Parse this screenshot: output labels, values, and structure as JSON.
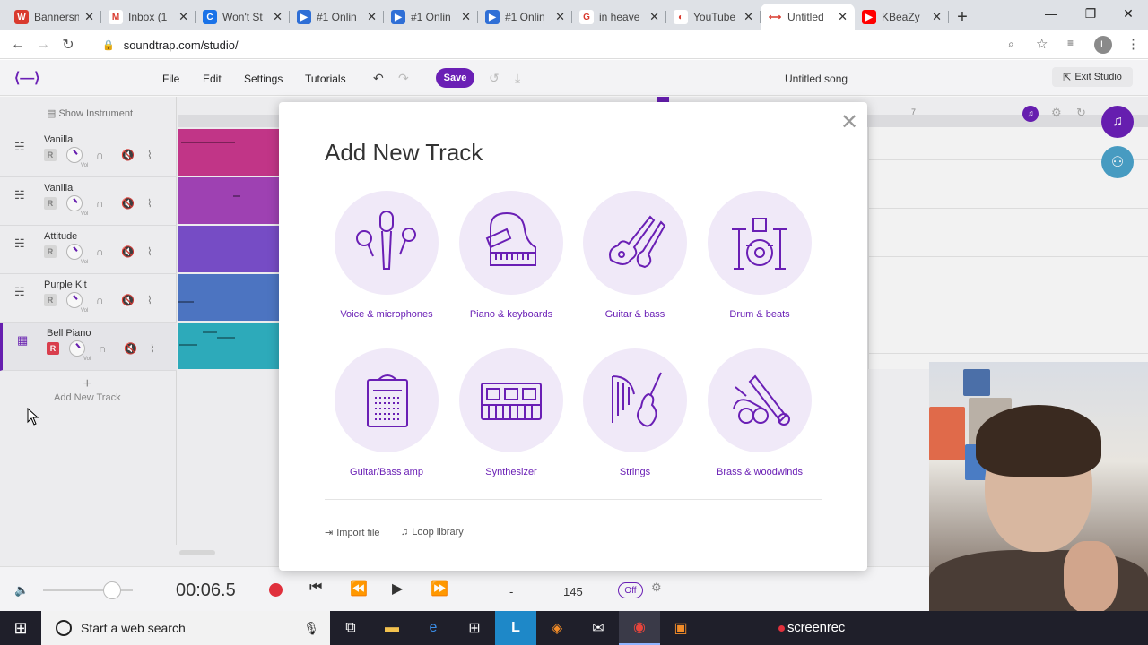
{
  "browser": {
    "tabs": [
      {
        "title": "Bannersn",
        "color": "#d93a2e",
        "glyph": "W",
        "active": false
      },
      {
        "title": "Inbox (1",
        "color": "#ffffff",
        "glyph": "M",
        "active": false
      },
      {
        "title": "Won't St",
        "color": "#1a73e8",
        "glyph": "C",
        "active": false
      },
      {
        "title": "#1 Onlin",
        "color": "#2f6fd6",
        "glyph": "▶",
        "active": false
      },
      {
        "title": "#1 Onlin",
        "color": "#2f6fd6",
        "glyph": "▶",
        "active": false
      },
      {
        "title": "#1 Onlin",
        "color": "#2f6fd6",
        "glyph": "▶",
        "active": false
      },
      {
        "title": "in heave",
        "color": "#ffffff",
        "glyph": "G",
        "active": false
      },
      {
        "title": "YouTube",
        "color": "#ffffff",
        "glyph": "◐",
        "active": false
      },
      {
        "title": "Untitled",
        "color": "#ffffff",
        "glyph": "⟷",
        "active": true
      },
      {
        "title": "KBeaZy",
        "color": "#ff0000",
        "glyph": "▶",
        "active": false
      }
    ],
    "url": "soundtrap.com/studio/",
    "profile_initial": "L"
  },
  "studio": {
    "logo": "⟨—⟩",
    "menu": {
      "file": "File",
      "edit": "Edit",
      "settings": "Settings",
      "tutorials": "Tutorials"
    },
    "save_label": "Save",
    "song_title": "Untitled song",
    "exit_label": "Exit Studio",
    "show_instrument": "Show Instrument",
    "ruler_mark": "7",
    "tracks": [
      {
        "name": "Vanilla",
        "icon": "drum-icon",
        "color": "#c8378c",
        "armed": false
      },
      {
        "name": "Vanilla",
        "icon": "drum-icon",
        "color": "#a444b8",
        "armed": false
      },
      {
        "name": "Attitude",
        "icon": "drum-icon",
        "color": "#7a4fcc",
        "armed": false
      },
      {
        "name": "Purple Kit",
        "icon": "drum-icon",
        "color": "#4f78c8",
        "armed": false
      },
      {
        "name": "Bell Piano",
        "icon": "keyboard-icon",
        "color": "#2fb0c0",
        "armed": true
      }
    ],
    "rec_label": "R",
    "vol_label": "Vol",
    "add_track_label": "Add New Track"
  },
  "transport": {
    "time": "00:06.5",
    "key": "-",
    "tempo": "145",
    "metronome": "Off",
    "volume_level": 0.77
  },
  "modal": {
    "title": "Add New Track",
    "categories": [
      {
        "label": "Voice & microphones",
        "icon": "microphone-icon"
      },
      {
        "label": "Piano & keyboards",
        "icon": "piano-icon"
      },
      {
        "label": "Guitar & bass",
        "icon": "guitar-icon"
      },
      {
        "label": "Drum & beats",
        "icon": "drum-kit-icon"
      },
      {
        "label": "Guitar/Bass amp",
        "icon": "amp-icon"
      },
      {
        "label": "Synthesizer",
        "icon": "synthesizer-icon"
      },
      {
        "label": "Strings",
        "icon": "harp-violin-icon"
      },
      {
        "label": "Brass & woodwinds",
        "icon": "brass-icon"
      }
    ],
    "import_label": "Import file",
    "loop_label": "Loop library"
  },
  "taskbar": {
    "search_placeholder": "Start a web search",
    "screenrec_label": "screenrec"
  },
  "colors": {
    "accent": "#6a1fb5",
    "record": "#e0303c"
  }
}
